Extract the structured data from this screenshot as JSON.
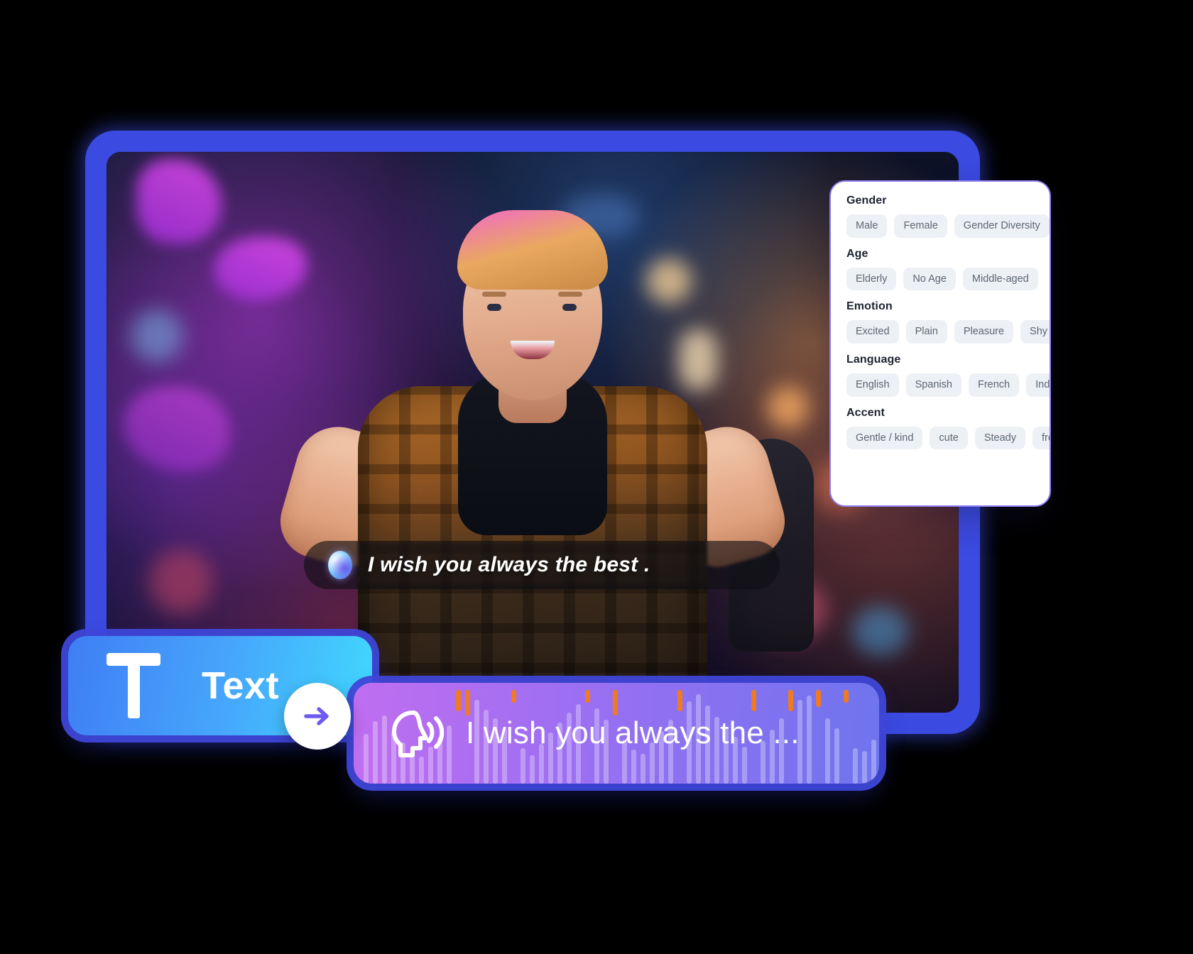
{
  "video": {
    "caption": {
      "text": "I wish you always the best .",
      "orb_icon": "gradient-orb-icon"
    }
  },
  "attributes_panel": {
    "groups": [
      {
        "title": "Gender",
        "options": [
          "Male",
          "Female",
          "Gender Diversity"
        ]
      },
      {
        "title": "Age",
        "options": [
          "Elderly",
          "No Age",
          "Middle-aged"
        ]
      },
      {
        "title": "Emotion",
        "options": [
          "Excited",
          "Plain",
          "Pleasure",
          "Shy"
        ]
      },
      {
        "title": "Language",
        "options": [
          "English",
          "Spanish",
          "French",
          "Indo"
        ]
      },
      {
        "title": "Accent",
        "options": [
          "Gentle / kind",
          "cute",
          "Steady",
          "fre"
        ]
      }
    ]
  },
  "text_button": {
    "label": "Text",
    "icon": "text-t-icon"
  },
  "arrow_button": {
    "icon": "arrow-right-icon"
  },
  "voice_bar": {
    "text": "I wish you always the ...",
    "icon": "speaking-head-icon"
  },
  "colors": {
    "frame_border": "#3b4ae0",
    "panel_border": "#8f7cf0",
    "text_button_gradient_start": "#3f7ef5",
    "text_button_gradient_end": "#41d8fd",
    "voice_bar_gradient_start": "#c06ef0",
    "voice_bar_gradient_end": "#6e74ee",
    "waveform_accent": "#f07a22",
    "chip_background": "#edf0f4",
    "chip_text": "#5d6674"
  }
}
